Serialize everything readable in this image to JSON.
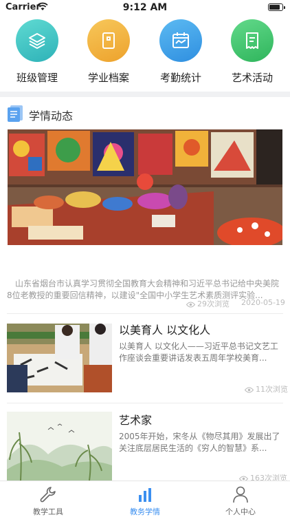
{
  "status_bar": {
    "carrier": "Carrier",
    "time": "9:12 AM"
  },
  "quick_actions": [
    {
      "label": "班级管理",
      "icon": "layers-icon",
      "color": "#3ec6c0"
    },
    {
      "label": "学业档案",
      "icon": "folder-icon",
      "color": "#f0b23c"
    },
    {
      "label": "考勤统计",
      "icon": "calendar-icon",
      "color": "#3aa0e8"
    },
    {
      "label": "艺术活动",
      "icon": "receipt-icon",
      "color": "#3cc46a"
    }
  ],
  "section": {
    "title": "学情动态"
  },
  "featured": {
    "desc": "山东省烟台市认真学习贯彻全国教育大会精神和习近平总书记给中央美院8位老教授的重要回信精神，以建设\"全国中小学生艺术素质测评实验...",
    "views": "29次浏览",
    "date": "2020-05-19"
  },
  "articles": [
    {
      "title": "以美育人 以文化人",
      "desc": "以美育人 以文化人——习近平总书记文艺工作座谈会重要讲话发表五周年学校美育...",
      "views": "11次浏览"
    },
    {
      "title": "艺术家",
      "desc": "2005年开始，宋冬从《物尽其用》发展出了关注底层居民生活的《穷人的智慧》系...",
      "views": "163次浏览"
    }
  ],
  "tabs": [
    {
      "label": "教学工具",
      "icon": "wrench-icon"
    },
    {
      "label": "教务学情",
      "icon": "bar-chart-icon"
    },
    {
      "label": "个人中心",
      "icon": "person-icon"
    }
  ],
  "colors": {
    "accent": "#3b8ff0",
    "muted": "#999999",
    "divider": "#f0f1f3"
  }
}
